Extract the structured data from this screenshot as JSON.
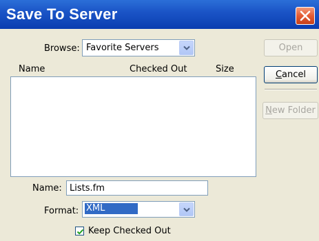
{
  "window": {
    "title": "Save To Server"
  },
  "browse": {
    "label": "Browse:",
    "selected": "Favorite Servers"
  },
  "file_list": {
    "columns": [
      "Name",
      "Checked Out",
      "Size"
    ],
    "rows": []
  },
  "buttons": {
    "open": "Open",
    "cancel_prefix": "C",
    "cancel_rest": "ancel",
    "new_folder_prefix": "N",
    "new_folder_rest": "ew Folder"
  },
  "name_field": {
    "label": "Name:",
    "value": "Lists.fm"
  },
  "format": {
    "label": "Format:",
    "selected": "XML"
  },
  "keep_checked_out": {
    "label": "Keep Checked Out",
    "checked": true
  },
  "colors": {
    "titlebar": "#0a3db0",
    "close": "#e45b34",
    "selection": "#316ac5"
  }
}
